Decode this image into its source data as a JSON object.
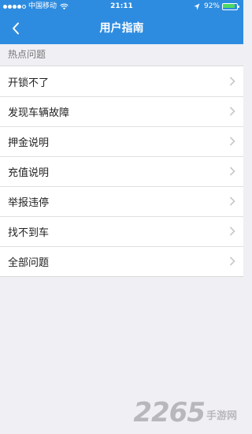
{
  "status_bar": {
    "carrier": "中国移动",
    "time": "21:11",
    "battery_percent": "92%",
    "battery_level": 0.92,
    "battery_color": "#4cd964"
  },
  "nav": {
    "title": "用户指南",
    "back_icon": "chevron-left-icon",
    "background_color": "#2e8ce0"
  },
  "section": {
    "title": "热点问题"
  },
  "faq_items": [
    {
      "label": "开锁不了"
    },
    {
      "label": "发现车辆故障"
    },
    {
      "label": "押金说明"
    },
    {
      "label": "充值说明"
    },
    {
      "label": "举报违停"
    },
    {
      "label": "找不到车"
    },
    {
      "label": "全部问题"
    }
  ],
  "watermark": {
    "number": "2265",
    "text": "手游网"
  }
}
